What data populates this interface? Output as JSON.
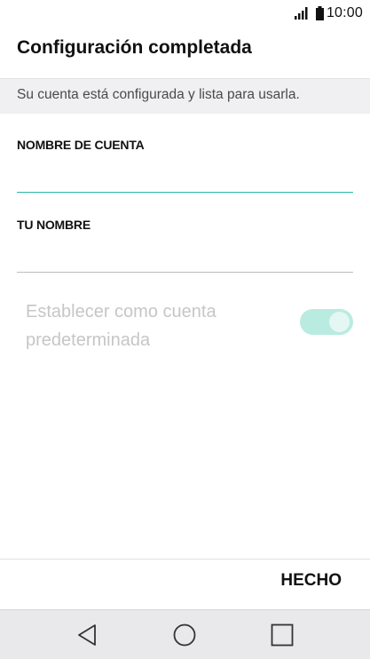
{
  "status_bar": {
    "time": "10:00",
    "signal_icon": "signal-icon",
    "battery_icon": "battery-icon"
  },
  "header": {
    "title": "Configuración completada",
    "subtitle": "Su cuenta está configurada y lista para usarla."
  },
  "form": {
    "account_name": {
      "label": "NOMBRE DE CUENTA",
      "value": ""
    },
    "your_name": {
      "label": "TU NOMBRE",
      "value": ""
    },
    "default_account": {
      "label": "Establecer como cuenta predeterminada",
      "enabled": false,
      "checked": true
    }
  },
  "actions": {
    "done_label": "HECHO"
  },
  "nav": {
    "back_icon": "back-icon",
    "home_icon": "home-icon",
    "recents_icon": "recents-icon"
  },
  "colors": {
    "accent": "#2bb8a6",
    "toggle_track_disabled": "#b9ebe1",
    "disabled_text": "#c6c6c6",
    "subtitle_band": "#f0f0f2",
    "nav_bar": "#e9e9eb"
  }
}
